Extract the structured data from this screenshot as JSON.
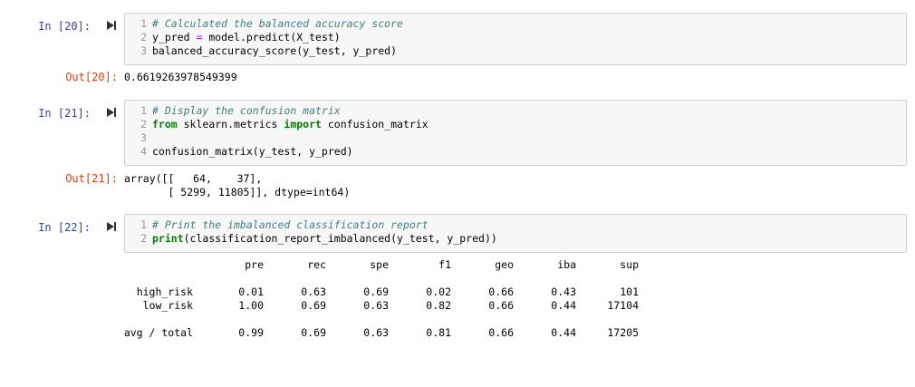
{
  "cells": [
    {
      "in_prompt": "In [20]:",
      "lines": [
        {
          "n": "1",
          "text": "# Calculated the balanced accuracy score",
          "type": "comment"
        },
        {
          "n": "2",
          "text": "y_pred = model.predict(X_test)",
          "type": "code"
        },
        {
          "n": "3",
          "text": "balanced_accuracy_score(y_test, y_pred)",
          "type": "code"
        }
      ],
      "out_prompt": "Out[20]:",
      "output": "0.6619263978549399"
    },
    {
      "in_prompt": "In [21]:",
      "lines": [
        {
          "n": "1",
          "text": "# Display the confusion matrix",
          "type": "comment"
        },
        {
          "n": "2",
          "text": "from sklearn.metrics import confusion_matrix",
          "type": "code"
        },
        {
          "n": "3",
          "text": "",
          "type": "code"
        },
        {
          "n": "4",
          "text": "confusion_matrix(y_test, y_pred)",
          "type": "code"
        }
      ],
      "out_prompt": "Out[21]:",
      "output_line1": "array([[   64,    37],",
      "output_line2": "       [ 5299, 11805]], dtype=int64)"
    },
    {
      "in_prompt": "In [22]:",
      "lines": [
        {
          "n": "1",
          "text": "# Print the imbalanced classification report",
          "type": "comment"
        },
        {
          "n": "2",
          "text": "print(classification_report_imbalanced(y_test, y_pred))",
          "type": "code"
        }
      ]
    }
  ],
  "report": {
    "headers": [
      "pre",
      "rec",
      "spe",
      "f1",
      "geo",
      "iba",
      "sup"
    ],
    "rows": [
      {
        "label": "high_risk",
        "values": [
          "0.01",
          "0.63",
          "0.69",
          "0.02",
          "0.66",
          "0.43",
          "101"
        ]
      },
      {
        "label": "low_risk",
        "values": [
          "1.00",
          "0.69",
          "0.63",
          "0.82",
          "0.66",
          "0.44",
          "17104"
        ]
      },
      {
        "label": "avg / total",
        "values": [
          "0.99",
          "0.69",
          "0.63",
          "0.81",
          "0.66",
          "0.44",
          "17205"
        ]
      }
    ]
  },
  "icons": {
    "run": "run-cell-icon"
  },
  "colors": {
    "in_prompt": "#303f9f",
    "out_prompt": "#d84315",
    "cell_bg": "#f7f7f7",
    "comment": "#408080"
  }
}
